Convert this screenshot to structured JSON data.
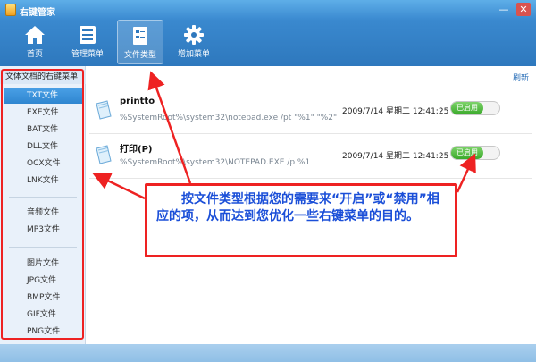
{
  "window": {
    "title": "右键管家",
    "minimize": "—",
    "close": "✕"
  },
  "toolbar": {
    "items": [
      {
        "label": "首页",
        "icon": "home-icon",
        "active": false
      },
      {
        "label": "管理菜单",
        "icon": "list-icon",
        "active": false
      },
      {
        "label": "文件类型",
        "icon": "filetype-icon",
        "active": true
      },
      {
        "label": "增加菜单",
        "icon": "gear-icon",
        "active": false
      }
    ]
  },
  "sidebar": {
    "header": "文体文档的右键菜单",
    "groups": [
      [
        "TXT文件",
        "EXE文件",
        "BAT文件",
        "DLL文件",
        "OCX文件",
        "LNK文件"
      ],
      [
        "音频文件",
        "MP3文件"
      ],
      [
        "图片文件",
        "JPG文件",
        "BMP文件",
        "GIF文件",
        "PNG文件"
      ]
    ],
    "selected": "TXT文件"
  },
  "main": {
    "refresh": "刷新",
    "rows": [
      {
        "name": "printto",
        "command": "%SystemRoot%\\system32\\notepad.exe /pt \"%1\" \"%2\" \"%...",
        "date": "2009/7/14 星期二 12:41:25",
        "status": "已启用"
      },
      {
        "name": "打印(P)",
        "command": "%SystemRoot%\\system32\\NOTEPAD.EXE /p %1",
        "date": "2009/7/14 星期二 12:41:25",
        "status": "已启用"
      }
    ]
  },
  "callout": {
    "text": "按文件类型根据您的需要来“开启”或“禁用”相应的项，从而达到您优化一些右键菜单的目的。"
  },
  "colors": {
    "accent": "#3a89cf",
    "annotation": "#e22222",
    "callout_text": "#1b4fd8",
    "toggle_on": "#3aa92a"
  }
}
